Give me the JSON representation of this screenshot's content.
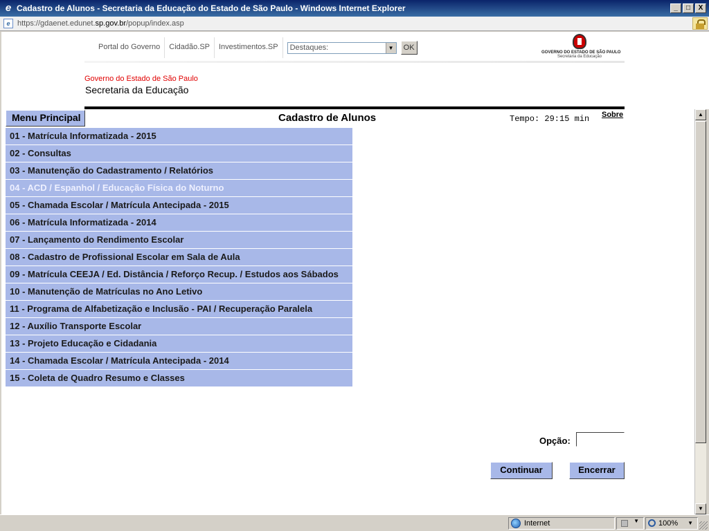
{
  "window": {
    "title": "Cadastro de Alunos - Secretaria da Educação do Estado de São Paulo - Windows Internet Explorer",
    "buttons": {
      "minimize": "_",
      "maximize": "□",
      "close": "X"
    }
  },
  "address": {
    "prefix": "https://gdaenet.edunet.",
    "domain": "sp.gov.br",
    "path": "/popup/index.asp"
  },
  "header": {
    "links": [
      "Portal do Governo",
      "Cidadão.SP",
      "Investimentos.SP"
    ],
    "destaques_value": "Destaques:",
    "ok_label": "OK",
    "logo_line1": "GOVERNO DO ESTADO DE SÃO PAULO",
    "logo_line2": "Secretaria da Educação",
    "gov_name": "Governo do Estado de São Paulo",
    "sec_name": "Secretaria da Educação"
  },
  "page": {
    "menu_principal": "Menu Principal",
    "title": "Cadastro de Alunos",
    "tempo": "Tempo: 29:15 min",
    "sobre": "Sobre"
  },
  "menu": {
    "items": [
      "01 - Matrícula Informatizada - 2015",
      "02 - Consultas",
      "03 - Manutenção do Cadastramento / Relatórios",
      "04 - ACD / Espanhol / Educação Física do Noturno",
      "05 - Chamada Escolar / Matrícula Antecipada - 2015",
      "06 - Matrícula Informatizada - 2014",
      "07 - Lançamento do Rendimento Escolar",
      "08 - Cadastro de Profissional Escolar em Sala de Aula",
      "09 - Matrícula CEEJA / Ed. Distância / Reforço Recup. / Estudos aos Sábados",
      "10 - Manutenção de Matrículas no Ano Letivo",
      "11 - Programa de Alfabetização e Inclusão - PAI / Recuperação Paralela",
      "12 - Auxílio Transporte Escolar",
      "13 - Projeto Educação e Cidadania",
      "14 - Chamada Escolar / Matrícula Antecipada - 2014",
      "15 - Coleta de Quadro Resumo e Classes"
    ],
    "disabled_index": 3
  },
  "form": {
    "opcao_label": "Opção:",
    "opcao_value": "",
    "continuar_label": "Continuar",
    "encerrar_label": "Encerrar"
  },
  "status": {
    "zone": "Internet",
    "zoom": "100%"
  },
  "colors": {
    "menu_bg": "#a8b8e8",
    "gov_red": "#e00000"
  }
}
